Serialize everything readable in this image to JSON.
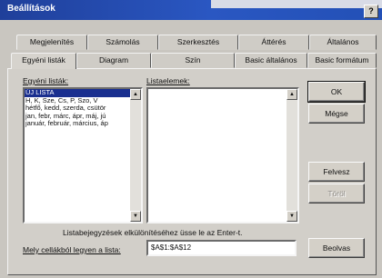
{
  "window": {
    "title": "Beállítások",
    "help_glyph": "?"
  },
  "tabs_row1": [
    {
      "label": "Megjelenítés"
    },
    {
      "label": "Számolás"
    },
    {
      "label": "Szerkesztés"
    },
    {
      "label": "Áttérés"
    },
    {
      "label": "Általános"
    }
  ],
  "tabs_row2": [
    {
      "label": "Egyéni listák",
      "active": true
    },
    {
      "label": "Diagram"
    },
    {
      "label": "Szín"
    },
    {
      "label": "Basic általános"
    },
    {
      "label": "Basic formátum"
    }
  ],
  "custom_lists": {
    "label": "Egyéni listák:",
    "items": [
      "ÚJ LISTA",
      "H, K, Sze, Cs, P, Szo, V",
      "hétfő, kedd, szerda, csütör",
      "jan, febr, márc, ápr, máj, jú",
      "január, február, március, áp"
    ]
  },
  "list_entries": {
    "label": "Listaelemek:"
  },
  "buttons": {
    "ok": "OK",
    "cancel": "Mégse",
    "add": "Felvesz",
    "delete": "Töröl",
    "import": "Beolvas"
  },
  "hint": "Listabejegyzések elkülönítéséhez üsse le az Enter-t.",
  "import_range": {
    "label": "Mely cellákból legyen a lista:",
    "value": "$A$1:$A$12"
  },
  "scroll_up_glyph": "▲",
  "scroll_down_glyph": "▼"
}
